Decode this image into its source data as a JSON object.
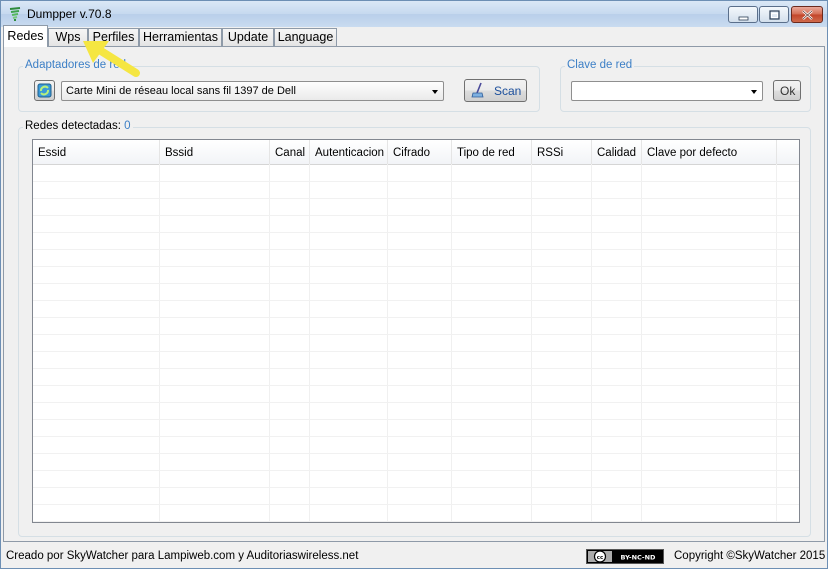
{
  "window": {
    "title": "Dumpper v.70.8",
    "icon": "wifi-signal-icon"
  },
  "tabs": [
    {
      "label": "Redes",
      "active": true
    },
    {
      "label": "Wps",
      "active": false
    },
    {
      "label": "Perfiles",
      "active": false
    },
    {
      "label": "Herramientas",
      "active": false
    },
    {
      "label": "Update",
      "active": false
    },
    {
      "label": "Language",
      "active": false
    }
  ],
  "adapters": {
    "legend": "Adaptadores de red",
    "refresh_icon": "refresh-icon",
    "selected": "Carte Mini de réseau local sans fil 1397 de Dell",
    "scan_label": "Scan",
    "scan_icon": "broom-icon"
  },
  "network_key": {
    "legend": "Clave de red",
    "selected": "",
    "ok_label": "Ok"
  },
  "networks": {
    "label": "Redes detectadas:",
    "count": "0",
    "columns": [
      "Essid",
      "Bssid",
      "Canal",
      "Autenticacion",
      "Cifrado",
      "Tipo de red",
      "RSSi",
      "Calidad",
      "Clave por defecto"
    ],
    "rows": []
  },
  "status": {
    "credits": "Creado por SkyWatcher para Lampiweb.com y Auditoriaswireless.net",
    "license_badge": "BY-NC-ND",
    "copyright": "Copyright ©SkyWatcher 2015"
  },
  "annotation": {
    "arrow_color": "#f5e642"
  }
}
